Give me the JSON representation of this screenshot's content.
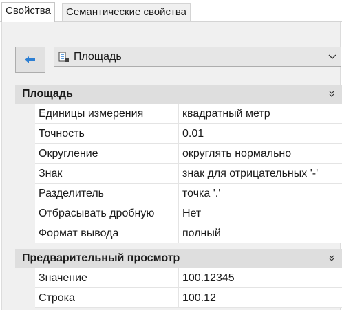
{
  "tabs": [
    {
      "label": "Свойства",
      "active": true
    },
    {
      "label": "Семантические свойства",
      "active": false
    }
  ],
  "toolbar": {
    "back_icon": "arrow-left-icon",
    "combo_icon": "area-measure-icon",
    "combo_value": "Площадь"
  },
  "groups": [
    {
      "title": "Площадь",
      "rows": [
        {
          "name": "Единицы измерения",
          "value": "квадратный метр"
        },
        {
          "name": "Точность",
          "value": "0.01"
        },
        {
          "name": "Округление",
          "value": "округлять нормально"
        },
        {
          "name": "Знак",
          "value": "знак для отрицательных '-'"
        },
        {
          "name": "Разделитель",
          "value": "точка '.'"
        },
        {
          "name": "Отбрасывать дробную",
          "value": "Нет"
        },
        {
          "name": "Формат вывода",
          "value": "полный"
        }
      ]
    },
    {
      "title": "Предварительный просмотр",
      "rows": [
        {
          "name": "Значение",
          "value": "100.12345"
        },
        {
          "name": "Строка",
          "value": "100.12"
        }
      ]
    }
  ],
  "colors": {
    "group_header_bg": "#dedede",
    "panel_bg": "#f0f0f0",
    "arrow_blue": "#2d7fd3"
  }
}
